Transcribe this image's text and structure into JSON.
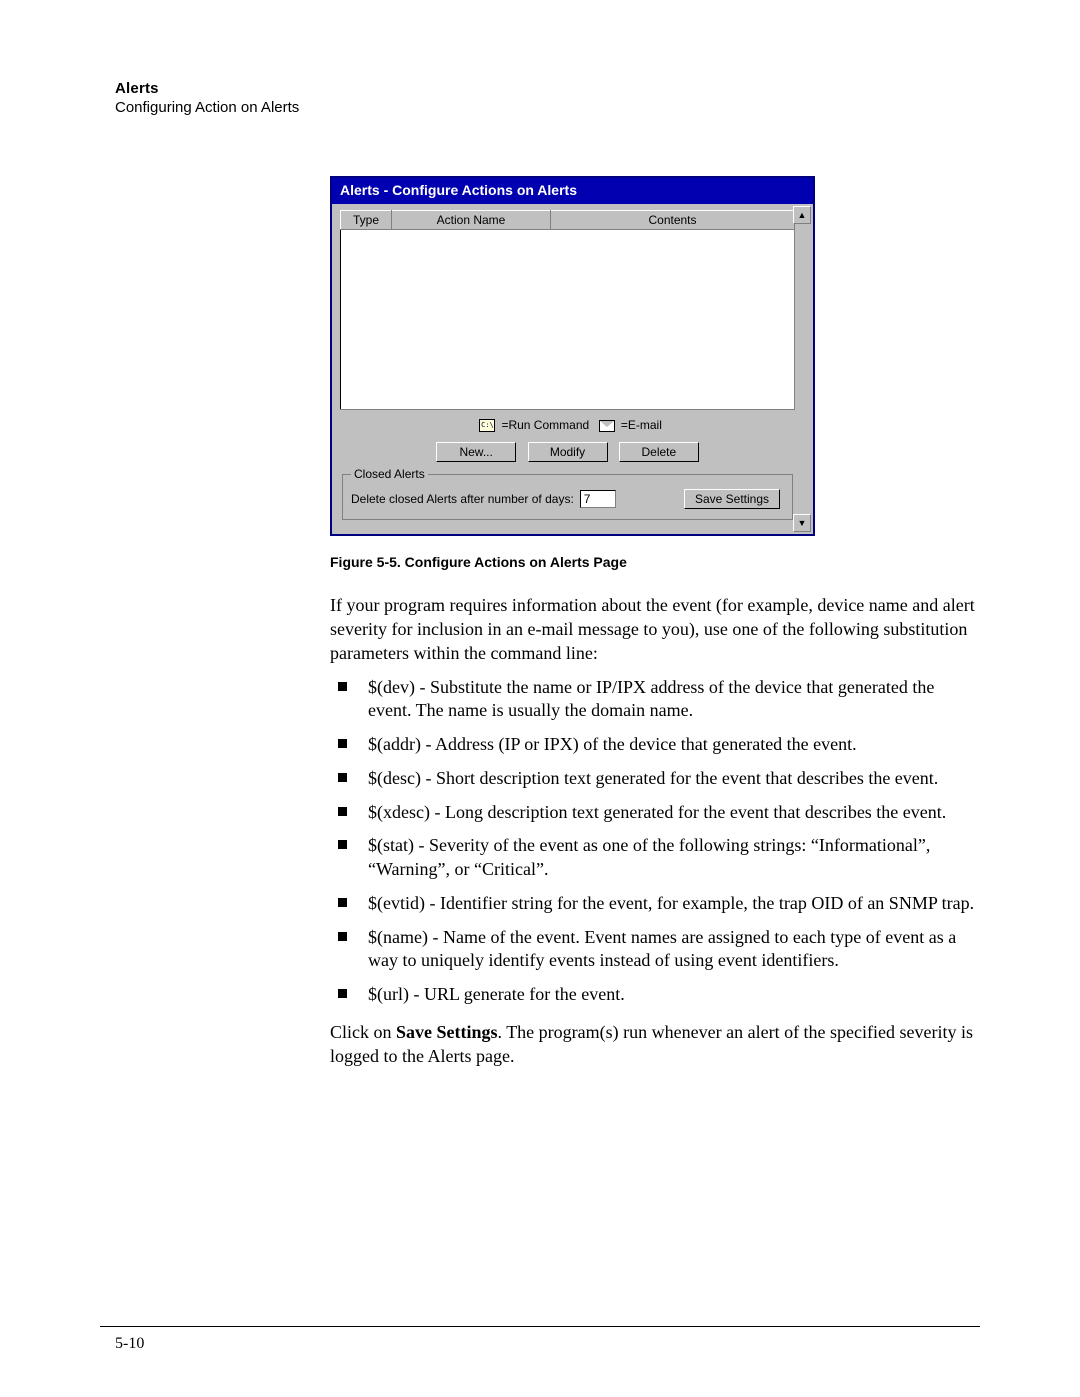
{
  "header": {
    "title": "Alerts",
    "subtitle": "Configuring Action on Alerts"
  },
  "window": {
    "title": "Alerts - Configure Actions on Alerts",
    "columns": {
      "type": "Type",
      "action_name": "Action Name",
      "contents": "Contents"
    },
    "legend": {
      "run_command": "=Run Command",
      "email": "=E-mail"
    },
    "buttons": {
      "new": "New...",
      "modify": "Modify",
      "delete": "Delete"
    },
    "closed_alerts": {
      "legend": "Closed Alerts",
      "label": "Delete closed Alerts after number of days:",
      "days_value": "7",
      "save": "Save Settings"
    }
  },
  "figure_caption": "Figure 5-5.   Configure Actions on Alerts Page",
  "intro_para": "If your program requires information about the event (for example, device name and alert severity for inclusion in an e-mail message to you), use one of the following substitution parameters within the command line:",
  "bullets": [
    "$(dev) - Substitute the name or IP/IPX address of the device that generated the event. The name is usually the domain name.",
    "$(addr) - Address (IP or IPX) of the device that generated the event.",
    "$(desc) - Short description text generated for the event that describes the event.",
    "$(xdesc) - Long description text generated for the event that describes the event.",
    "$(stat) - Severity of the event as one of the following strings: “Informational”, “Warning”, or “Critical”.",
    "$(evtid) - Identifier string for the event, for example, the trap OID of an SNMP trap.",
    "$(name) - Name of the event. Event names are assigned to each type of event as a way to uniquely identify events instead of using event identifiers.",
    "$(url) - URL generate for the event."
  ],
  "closing": {
    "prefix": "Click on ",
    "bold": "Save Settings",
    "suffix": ". The program(s) run whenever an alert of the specified severity is logged to the Alerts page."
  },
  "page_number": "5-10"
}
